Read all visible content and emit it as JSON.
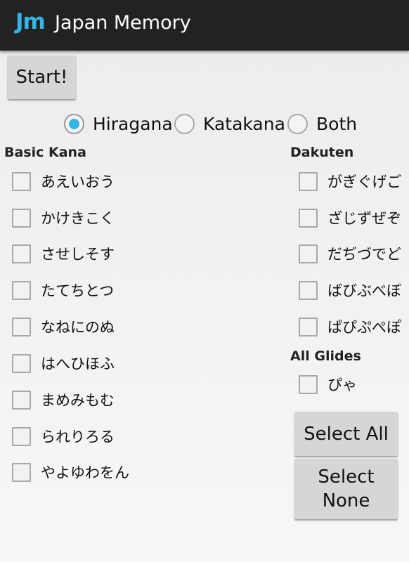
{
  "app": {
    "logo": "Jm",
    "title": "Japan Memory"
  },
  "start_label": "Start!",
  "modes": [
    {
      "label": "Hiragana",
      "checked": true
    },
    {
      "label": "Katakana",
      "checked": false
    },
    {
      "label": "Both",
      "checked": false
    }
  ],
  "basic": {
    "title": "Basic Kana",
    "items": [
      "あえいおう",
      "かけきこく",
      "させしそす",
      "たてちとつ",
      "なねにのぬ",
      "はへひほふ",
      "まめみもむ",
      "られりろる",
      "やよゆわをん"
    ]
  },
  "dakuten": {
    "title": "Dakuten",
    "items": [
      "がぎぐげご",
      "ざじずぜぞ",
      "だぢづでど",
      "ばびぶべぼ",
      "ぱぴぷぺぽ"
    ]
  },
  "glides": {
    "title": "All Glides",
    "items": [
      "ぴゃ"
    ]
  },
  "select_all_label": "Select All",
  "select_none_line1": "Select",
  "select_none_line2": "None",
  "colors": {
    "accent": "#33b5e5",
    "actionbar": "#222222"
  }
}
